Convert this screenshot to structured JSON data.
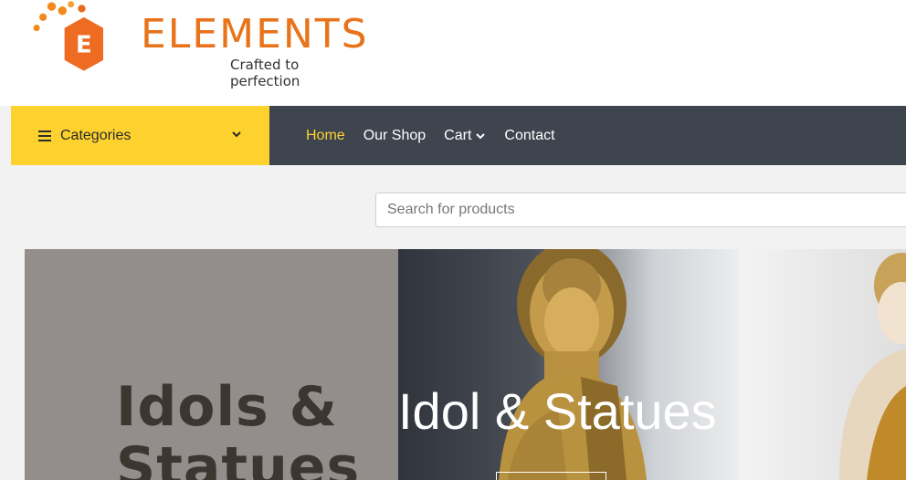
{
  "brand": {
    "name": "ELEMENTS",
    "tagline": "Crafted to perfection",
    "color": "#e8731a"
  },
  "nav": {
    "categories_label": "Categories",
    "links": [
      "Home",
      "Our Shop",
      "Cart",
      "Contact"
    ],
    "active": "Home",
    "accent": "#fdd22e",
    "bar_color": "#3e454f"
  },
  "search": {
    "placeholder": "Search for products"
  },
  "hero": {
    "side_text_line1": "Idols &",
    "side_text_line2": "Statues",
    "title": "Idol & Statues"
  },
  "icons": [
    "hamburger-icon",
    "chevron-down-icon",
    "logo-mark-icon"
  ]
}
